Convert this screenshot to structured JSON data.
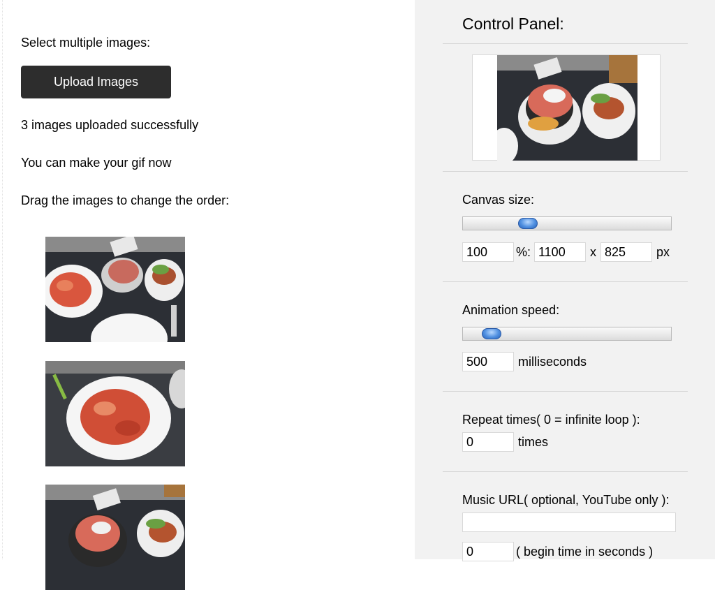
{
  "left": {
    "select_label": "Select multiple images:",
    "upload_button": "Upload Images",
    "status": "3 images uploaded successfully",
    "ready_text": "You can make your gif now",
    "drag_hint": "Drag the images to change the order:",
    "thumbnails": [
      "food-photo-1",
      "food-photo-2",
      "food-photo-3"
    ]
  },
  "panel": {
    "title": "Control Panel:",
    "canvas": {
      "label": "Canvas size:",
      "slider_level_fraction": 0.29,
      "percent_value": "100",
      "percent_sep": "%:",
      "width_value": "1100",
      "times_sep": "x",
      "height_value": "825",
      "unit": "px"
    },
    "speed": {
      "label": "Animation speed:",
      "slider_level_fraction": 0.1,
      "value": "500",
      "unit": "milliseconds"
    },
    "repeat": {
      "label": "Repeat times( 0 = infinite loop ):",
      "value": "0",
      "unit": "times"
    },
    "music": {
      "label": "Music URL( optional, YouTube only ):",
      "url_value": "",
      "begin_value": "0",
      "begin_label": "( begin time in seconds )"
    }
  },
  "colors": {
    "button_bg": "#2d2d2d",
    "panel_bg": "#f2f2f2",
    "slider_thumb": "#4f8fe0"
  }
}
